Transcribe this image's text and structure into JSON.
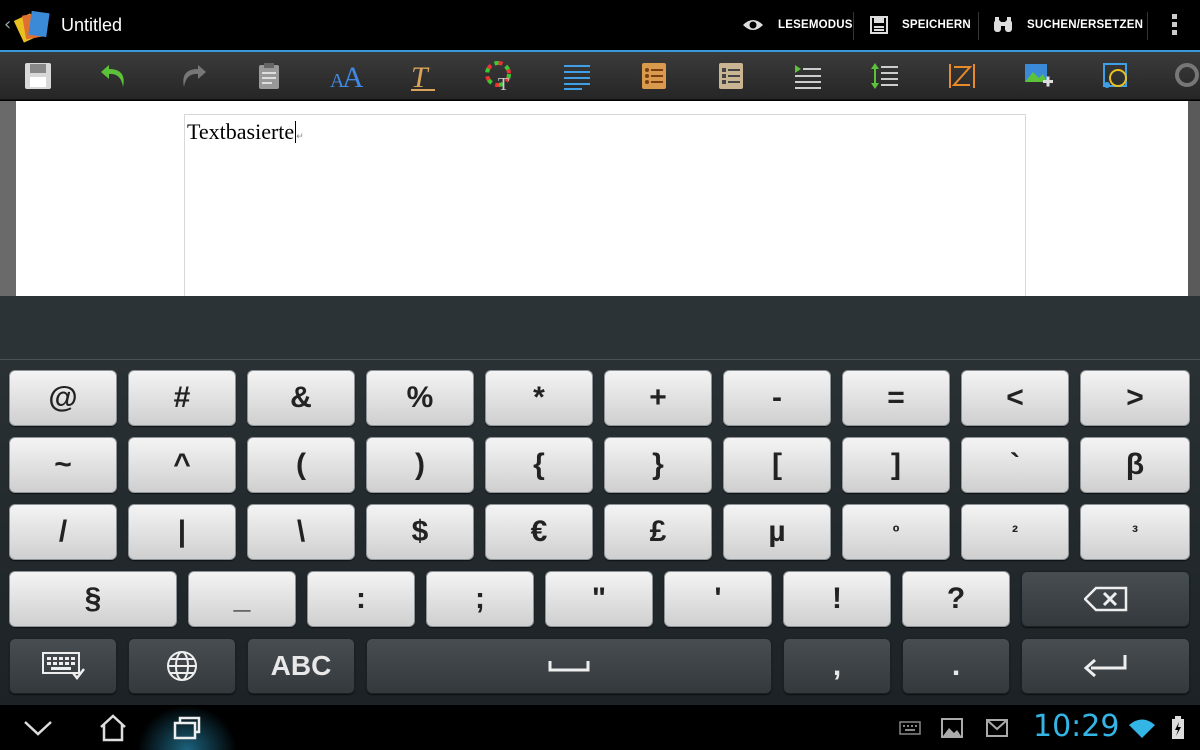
{
  "app": {
    "title": "Untitled"
  },
  "actions": {
    "reading_mode": "LESEMODUS",
    "save": "SPEICHERN",
    "search_replace": "SUCHEN/ERSETZEN"
  },
  "toolbar_icons": [
    "save-icon",
    "undo-icon",
    "redo-icon",
    "clipboard-icon",
    "font-size-icon",
    "text-style-icon",
    "text-color-icon",
    "align-left-icon",
    "bullet-list-icon",
    "numbered-list-icon",
    "indent-icon",
    "line-spacing-icon",
    "column-icon",
    "insert-image-icon",
    "shape-icon",
    "search-icon"
  ],
  "document": {
    "text": "Textbasierte"
  },
  "keyboard": {
    "row1": [
      "@",
      "#",
      "&",
      "%",
      "*",
      "+",
      "-",
      "=",
      "<",
      ">"
    ],
    "row2": [
      "~",
      "^",
      "(",
      ")",
      "{",
      "}",
      "[",
      "]",
      "`",
      "β"
    ],
    "row3": [
      "/",
      "|",
      "\\",
      "$",
      "€",
      "£",
      "µ",
      "º",
      "²",
      "³"
    ],
    "row4": [
      "§",
      "_",
      ":",
      ";",
      "\"",
      "'",
      "!",
      "?"
    ],
    "row5": {
      "mode": "ABC",
      "comma": ",",
      "period": "."
    }
  },
  "status": {
    "time": "10:29"
  },
  "colors": {
    "accent": "#33b5e5",
    "key_light": "#e6e6e6",
    "key_dark": "#3a4044"
  }
}
